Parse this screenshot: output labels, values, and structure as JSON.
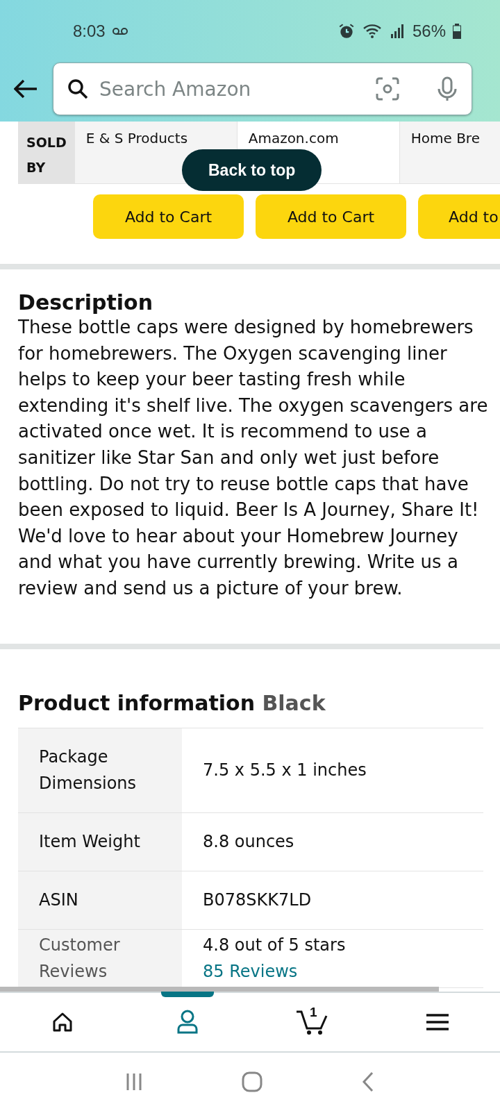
{
  "status_bar": {
    "time": "8:03",
    "battery": "56%"
  },
  "search": {
    "placeholder": "Search Amazon"
  },
  "comparison": {
    "row_label": "SOLD BY",
    "sellers": [
      "E & S Products",
      "Amazon.com",
      "Home Bre"
    ],
    "buttons": [
      "Add to Cart",
      "Add to Cart",
      "Add to"
    ]
  },
  "back_to_top": "Back to top",
  "description": {
    "title": "Description",
    "text": "These bottle caps were designed by homebrewers for homebrewers. The Oxygen scavenging liner helps to keep your beer tasting fresh while extending it's shelf live. The oxygen scavengers are activated once wet. It is recommend to use a sanitizer like Star San and only wet just before bottling. Do not try to reuse bottle caps that have been exposed to liquid. Beer Is A Journey, Share It! We'd love to hear about your Homebrew Journey and what you have currently brewing. Write us a review and send us a picture of your brew."
  },
  "product_information": {
    "title": "Product information",
    "variant": "Black",
    "rows": [
      {
        "label": "Package Dimensions",
        "value": "7.5 x 5.5 x 1 inches"
      },
      {
        "label": "Item Weight",
        "value": "8.8 ounces"
      },
      {
        "label": "ASIN",
        "value": "B078SKK7LD"
      },
      {
        "label": "Customer Reviews",
        "value": "4.8 out of 5 stars",
        "link": "85 Reviews"
      }
    ]
  },
  "bottom_nav": [
    {
      "kind": "home",
      "selected": false
    },
    {
      "kind": "account",
      "selected": true
    },
    {
      "kind": "cart",
      "selected": false,
      "count": "1"
    },
    {
      "kind": "menu",
      "selected": false
    }
  ]
}
